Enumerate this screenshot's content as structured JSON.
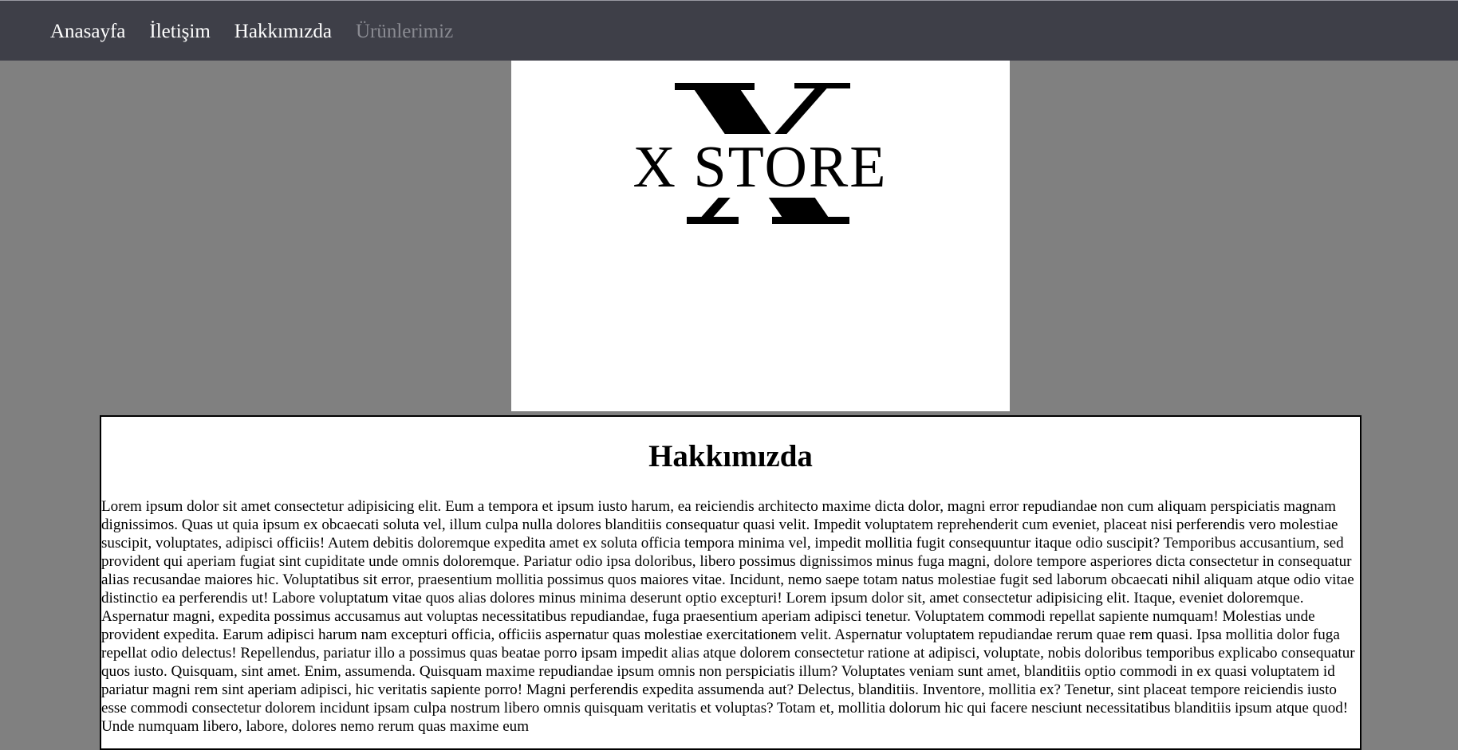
{
  "nav": {
    "items": [
      {
        "label": "Anasayfa",
        "active": false
      },
      {
        "label": "İletişim",
        "active": false
      },
      {
        "label": "Hakkımızda",
        "active": false
      },
      {
        "label": "Ürünlerimiz",
        "active": true
      }
    ]
  },
  "logo": {
    "text": "X STORE"
  },
  "about": {
    "title": "Hakkımızda",
    "body": "Lorem ipsum dolor sit amet consectetur adipisicing elit. Eum a tempora et ipsum iusto harum, ea reiciendis architecto maxime dicta dolor, magni error repudiandae non cum aliquam perspiciatis magnam dignissimos. Quas ut quia ipsum ex obcaecati soluta vel, illum culpa nulla dolores blanditiis consequatur quasi velit. Impedit voluptatem reprehenderit cum eveniet, placeat nisi perferendis vero molestiae suscipit, voluptates, adipisci officiis! Autem debitis doloremque expedita amet ex soluta officia tempora minima vel, impedit mollitia fugit consequuntur itaque odio suscipit? Temporibus accusantium, sed provident qui aperiam fugiat sint cupiditate unde omnis doloremque. Pariatur odio ipsa doloribus, libero possimus dignissimos minus fuga magni, dolore tempore asperiores dicta consectetur in consequatur alias recusandae maiores hic. Voluptatibus sit error, praesentium mollitia possimus quos maiores vitae. Incidunt, nemo saepe totam natus molestiae fugit sed laborum obcaecati nihil aliquam atque odio vitae distinctio ea perferendis ut! Labore voluptatum vitae quos alias dolores minus minima deserunt optio excepturi! Lorem ipsum dolor sit, amet consectetur adipisicing elit. Itaque, eveniet doloremque. Aspernatur magni, expedita possimus accusamus aut voluptas necessitatibus repudiandae, fuga praesentium aperiam adipisci tenetur. Voluptatem commodi repellat sapiente numquam! Molestias unde provident expedita. Earum adipisci harum nam excepturi officia, officiis aspernatur quas molestiae exercitationem velit. Aspernatur voluptatem repudiandae rerum quae rem quasi. Ipsa mollitia dolor fuga repellat odio delectus! Repellendus, pariatur illo a possimus quas beatae porro ipsam impedit alias atque dolorem consectetur ratione at adipisci, voluptate, nobis doloribus temporibus explicabo consequatur quos iusto. Quisquam, sint amet. Enim, assumenda. Quisquam maxime repudiandae ipsum omnis non perspiciatis illum? Voluptates veniam sunt amet, blanditiis optio commodi in ex quasi voluptatem id pariatur magni rem sint aperiam adipisci, hic veritatis sapiente porro! Magni perferendis expedita assumenda aut? Delectus, blanditiis. Inventore, mollitia ex? Tenetur, sint placeat tempore reiciendis iusto esse commodi consectetur dolorem incidunt ipsam culpa nostrum libero omnis quisquam veritatis et voluptas? Totam et, mollitia dolorum hic qui facere nesciunt necessitatibus blanditiis ipsum atque quod! Unde numquam libero, labore, dolores nemo rerum quas maxime eum"
  }
}
